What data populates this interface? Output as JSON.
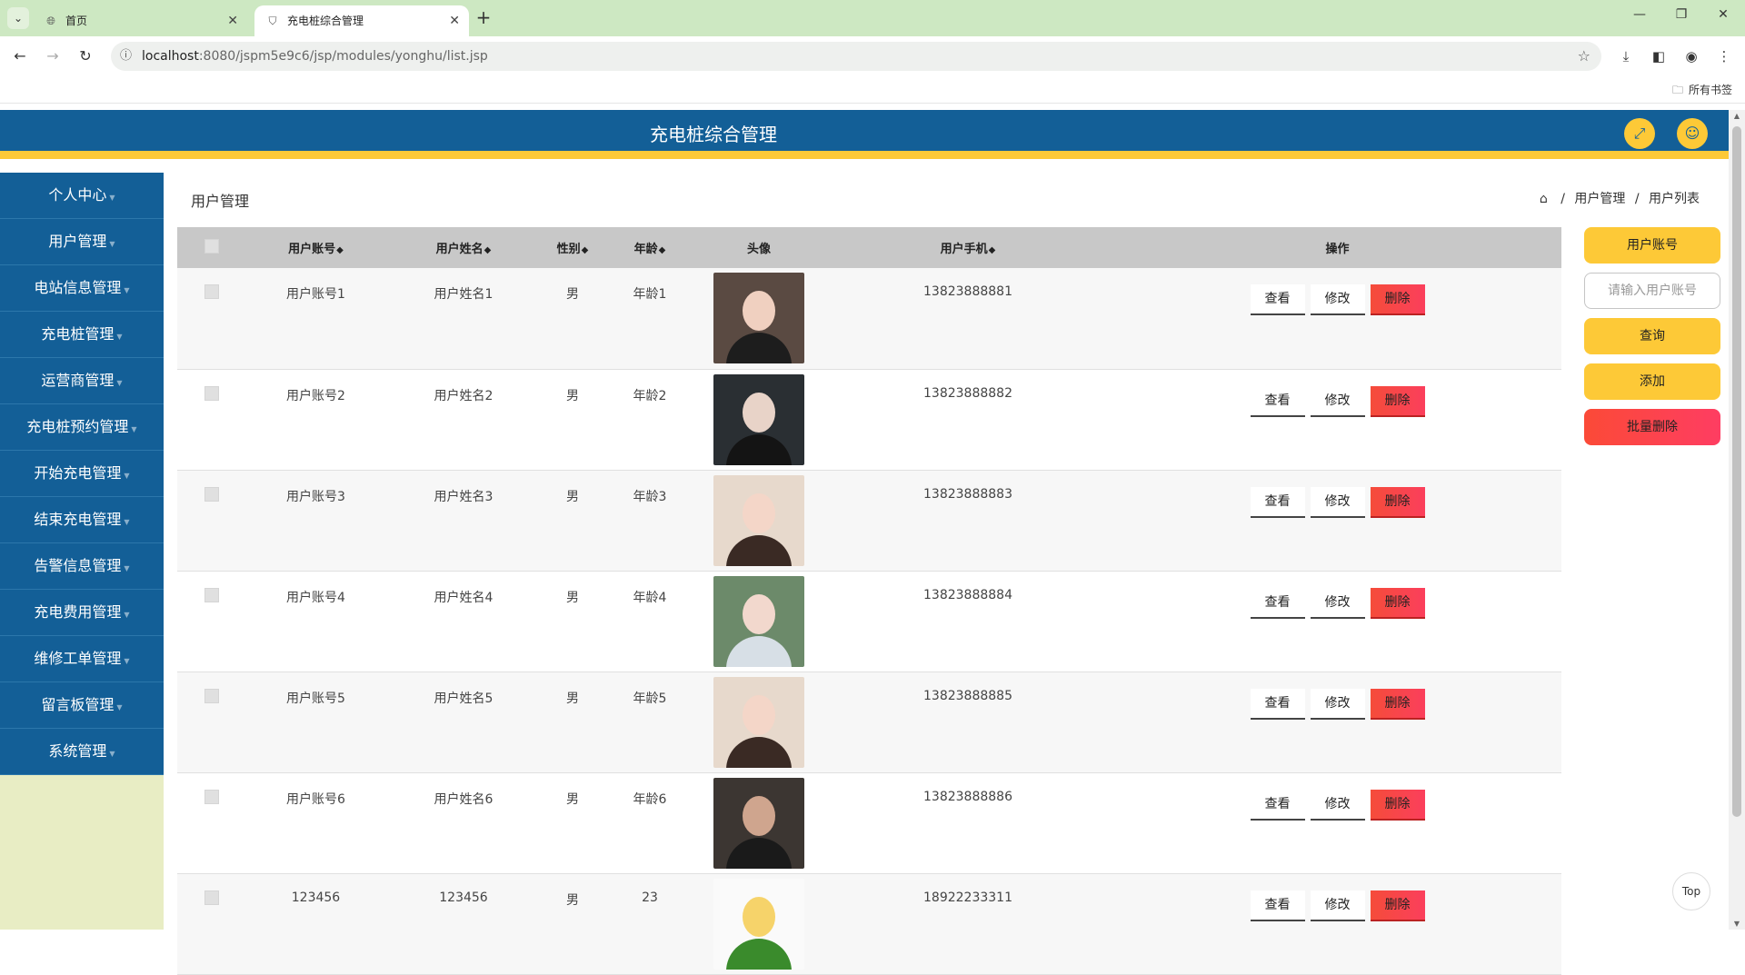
{
  "browser": {
    "tabs": [
      {
        "title": "首页",
        "icon": "globe-icon",
        "active": false
      },
      {
        "title": "充电桩综合管理",
        "icon": "shield-icon",
        "active": true
      }
    ],
    "url_host": "localhost",
    "url_path": ":8080/jspm5e9c6/jsp/modules/yonghu/list.jsp",
    "bookmarks_folder": "所有书签"
  },
  "app": {
    "title": "充电桩综合管理",
    "header_buttons": [
      "fullscreen-icon",
      "user-icon"
    ]
  },
  "sidebar": {
    "items": [
      {
        "label": "个人中心"
      },
      {
        "label": "用户管理"
      },
      {
        "label": "电站信息管理"
      },
      {
        "label": "充电桩管理"
      },
      {
        "label": "运营商管理"
      },
      {
        "label": "充电桩预约管理"
      },
      {
        "label": "开始充电管理"
      },
      {
        "label": "结束充电管理"
      },
      {
        "label": "告警信息管理"
      },
      {
        "label": "充电费用管理"
      },
      {
        "label": "维修工单管理"
      },
      {
        "label": "留言板管理"
      },
      {
        "label": "系统管理"
      }
    ]
  },
  "page": {
    "heading": "用户管理",
    "breadcrumb": [
      "用户管理",
      "用户列表"
    ]
  },
  "table": {
    "columns": [
      {
        "label": "用户账号",
        "sortable": true
      },
      {
        "label": "用户姓名",
        "sortable": true
      },
      {
        "label": "性别",
        "sortable": true
      },
      {
        "label": "年龄",
        "sortable": true
      },
      {
        "label": "头像",
        "sortable": false
      },
      {
        "label": "用户手机",
        "sortable": true
      },
      {
        "label": "操作",
        "sortable": false
      }
    ],
    "sort_glyph": "◆",
    "actions": {
      "view": "查看",
      "edit": "修改",
      "delete": "删除"
    },
    "rows": [
      {
        "account": "用户账号1",
        "name": "用户姓名1",
        "gender": "男",
        "age": "年龄1",
        "phone": "13823888881",
        "avatar_colors": [
          "#5a4a42",
          "#f0d0c0",
          "#1d1d1d"
        ]
      },
      {
        "account": "用户账号2",
        "name": "用户姓名2",
        "gender": "男",
        "age": "年龄2",
        "phone": "13823888882",
        "avatar_colors": [
          "#2a2f33",
          "#e8d3c8",
          "#141414"
        ]
      },
      {
        "account": "用户账号3",
        "name": "用户姓名3",
        "gender": "男",
        "age": "年龄3",
        "phone": "13823888883",
        "avatar_colors": [
          "#e7d9cc",
          "#f4d6c8",
          "#3a2a24"
        ]
      },
      {
        "account": "用户账号4",
        "name": "用户姓名4",
        "gender": "男",
        "age": "年龄4",
        "phone": "13823888884",
        "avatar_colors": [
          "#6c8a6a",
          "#f2d8cd",
          "#d7dfe6"
        ]
      },
      {
        "account": "用户账号5",
        "name": "用户姓名5",
        "gender": "男",
        "age": "年龄5",
        "phone": "13823888885",
        "avatar_colors": [
          "#e7d9cc",
          "#f4d6c8",
          "#3a2a24"
        ]
      },
      {
        "account": "用户账号6",
        "name": "用户姓名6",
        "gender": "男",
        "age": "年龄6",
        "phone": "13823888886",
        "avatar_colors": [
          "#3c3632",
          "#cfa58e",
          "#1a1a1a"
        ]
      },
      {
        "account": "123456",
        "name": "123456",
        "gender": "男",
        "age": "23",
        "phone": "18922233311",
        "avatar_colors": [
          "#fafafa",
          "#f6d36a",
          "#3a8b2c"
        ]
      }
    ]
  },
  "side_panel": {
    "field_label": "用户账号",
    "search_placeholder": "请输入用户账号",
    "query": "查询",
    "add": "添加",
    "batch_delete": "批量删除"
  },
  "top_button": "Top",
  "colors": {
    "header_blue": "#135f97",
    "accent_yellow": "#fdc937",
    "delete_red": "#f54c3a",
    "sidebar_bg": "#e8edc4"
  }
}
